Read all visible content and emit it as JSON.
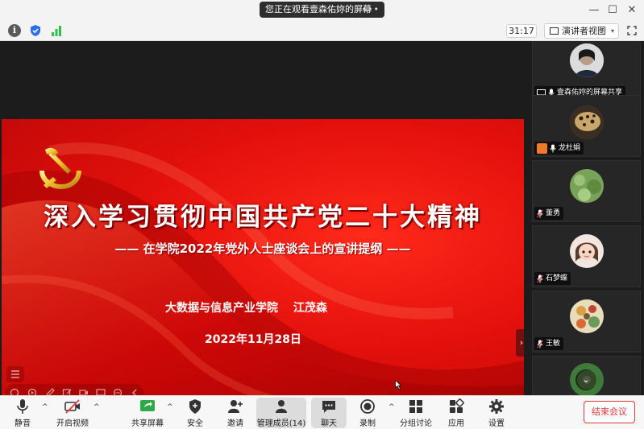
{
  "titlebar": {
    "viewing_text": "您正在观看壹森佑妳的屏幕",
    "more": "•••",
    "minimize": "—",
    "maximize": "☐",
    "close": "✕"
  },
  "statusbar": {
    "timer": "31:17",
    "speaker_view_label": "演讲者视图",
    "caret": "▾"
  },
  "slide": {
    "title": "深入学习贯彻中国共产党二十大精神",
    "subtitle": "—— 在学院2022年党外人士座谈会上的宣讲提纲 ——",
    "author": "大数据与信息产业学院　 江茂森",
    "date": "2022年11月28日",
    "collapse": "›"
  },
  "participants": [
    {
      "name": "壹森佑妳的屏幕共享",
      "sharing": true,
      "host": false
    },
    {
      "name": "龙杜娟",
      "sharing": false,
      "host": true
    },
    {
      "name": "董勇",
      "sharing": false,
      "host": false
    },
    {
      "name": "石梦蝶",
      "sharing": false,
      "host": false
    },
    {
      "name": "王敏",
      "sharing": false,
      "host": false
    }
  ],
  "panel": {
    "scroll_down": "⌄"
  },
  "toolbar": {
    "mute": "静音",
    "video": "开启视频",
    "share": "共享屏幕",
    "security": "安全",
    "invite": "邀请",
    "participants": "管理成员(14)",
    "chat": "聊天",
    "record": "录制",
    "breakout": "分组讨论",
    "apps": "应用",
    "settings": "设置",
    "end": "结束会议",
    "chevron": "^"
  },
  "colors": {
    "slide_red": "#e3100c",
    "end_red": "#e03a3a",
    "host_orange": "#f07a2a",
    "signal_green": "#2fbf4a",
    "shield_blue": "#2a6ee8"
  }
}
